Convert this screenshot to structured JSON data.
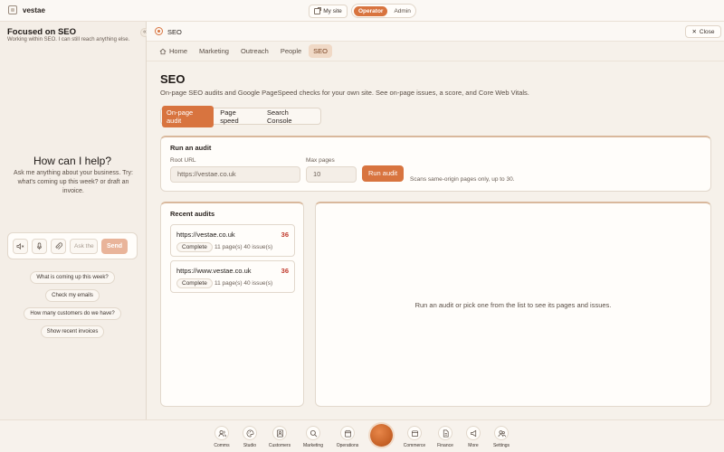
{
  "app": {
    "name": "vestae"
  },
  "topbar": {
    "my_site_label": "My site",
    "roles": [
      "Operator",
      "Admin"
    ],
    "active_role": "Operator"
  },
  "assistant": {
    "focus_title": "Focused on SEO",
    "focus_subtitle": "Working within SEO. I can still reach anything else.",
    "collapse_glyph": "«",
    "help_title": "How can I help?",
    "help_subtitle": "Ask me anything about your business. Try: what's coming up this week? or draft an invoice.",
    "input_placeholder": "Ask the",
    "send_label": "Send",
    "tools": [
      "mute-icon",
      "microphone-icon",
      "paperclip-icon"
    ],
    "suggestions": [
      "What is coming up this week?",
      "Check my emails",
      "How many customers do we have?",
      "Show recent invoices"
    ]
  },
  "pagehead": {
    "title": "SEO",
    "close_label": "Close"
  },
  "tabs": [
    {
      "label": "Home",
      "icon": "home-icon"
    },
    {
      "label": "Marketing"
    },
    {
      "label": "Outreach"
    },
    {
      "label": "People"
    },
    {
      "label": "SEO",
      "active": true
    }
  ],
  "main": {
    "title": "SEO",
    "subtitle": "On-page SEO audits and Google PageSpeed checks for your own site. See on-page issues, a score, and Core Web Vitals.",
    "subtabs": [
      "On-page audit",
      "Page speed",
      "Search Console"
    ],
    "active_subtab": "On-page audit"
  },
  "run_audit": {
    "title": "Run an audit",
    "root_url_label": "Root URL",
    "root_url_value": "https://vestae.co.uk",
    "max_pages_label": "Max pages",
    "max_pages_value": "10",
    "button_label": "Run audit",
    "hint": "Scans same-origin pages only, up to 30."
  },
  "recent_audits": {
    "title": "Recent audits",
    "items": [
      {
        "url": "https://vestae.co.uk",
        "score": "36",
        "status": "Complete",
        "meta": "11 page(s)  40 issue(s)"
      },
      {
        "url": "https://www.vestae.co.uk",
        "score": "36",
        "status": "Complete",
        "meta": "11 page(s)  40 issue(s)"
      }
    ]
  },
  "detail": {
    "empty_message": "Run an audit or pick one from the list to see its pages and issues."
  },
  "dock": [
    {
      "label": "Comms",
      "icon": "people-icon"
    },
    {
      "label": "Studio",
      "icon": "palette-icon"
    },
    {
      "label": "Customers",
      "icon": "contact-card-icon"
    },
    {
      "label": "Marketing",
      "icon": "search-icon"
    },
    {
      "label": "Operations",
      "icon": "calendar-icon"
    },
    {
      "label": "Commerce",
      "icon": "cart-icon"
    },
    {
      "label": "Finance",
      "icon": "document-icon"
    },
    {
      "label": "More",
      "icon": "megaphone-icon"
    },
    {
      "label": "Settings",
      "icon": "users-icon"
    }
  ],
  "colors": {
    "accent": "#d8743f",
    "score_bad": "#c0392b",
    "background": "#f6f1ea"
  }
}
